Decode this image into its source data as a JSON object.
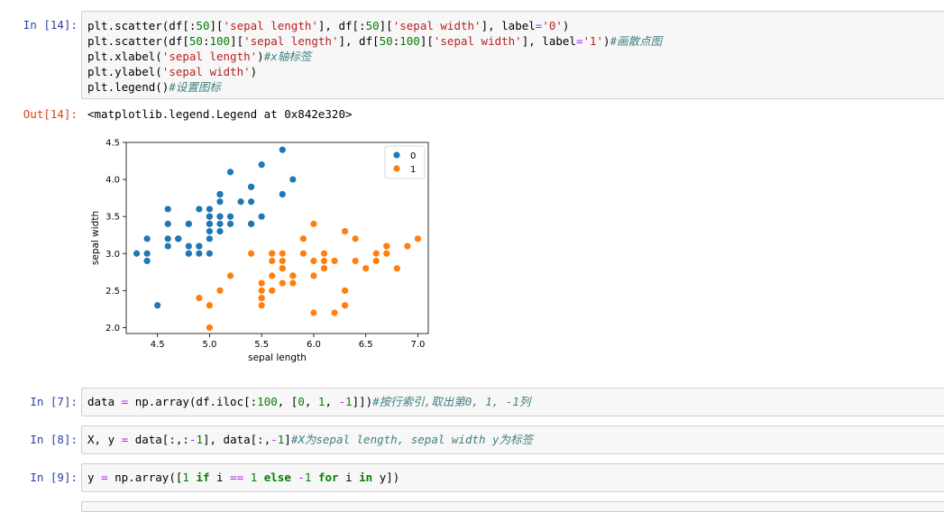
{
  "cells": {
    "c14": {
      "prompt": "In  [14]:",
      "out_prompt": "Out[14]:",
      "output": "<matplotlib.legend.Legend at 0x842e320>"
    },
    "c7": {
      "prompt": "In  [7]:"
    },
    "c8": {
      "prompt": "In  [8]:"
    },
    "c9": {
      "prompt": "In  [9]:"
    }
  },
  "code_tokens": {
    "c14_l1": [
      [
        "",
        "plt.scatter(df[:"
      ],
      [
        "num",
        "50"
      ],
      [
        "",
        "]["
      ],
      [
        "str",
        "'sepal length'"
      ],
      [
        "",
        "], df[:"
      ],
      [
        "num",
        "50"
      ],
      [
        "",
        "]["
      ],
      [
        "str",
        "'sepal width'"
      ],
      [
        "",
        "], label"
      ],
      [
        "op",
        "="
      ],
      [
        "str",
        "'0'"
      ],
      [
        "",
        ")"
      ]
    ],
    "c14_l2": [
      [
        "",
        "plt.scatter(df["
      ],
      [
        "num",
        "50"
      ],
      [
        "",
        ":"
      ],
      [
        "num",
        "100"
      ],
      [
        "",
        "]["
      ],
      [
        "str",
        "'sepal length'"
      ],
      [
        "",
        "], df["
      ],
      [
        "num",
        "50"
      ],
      [
        "",
        ":"
      ],
      [
        "num",
        "100"
      ],
      [
        "",
        "]["
      ],
      [
        "str",
        "'sepal width'"
      ],
      [
        "",
        "], label"
      ],
      [
        "op",
        "="
      ],
      [
        "str",
        "'1'"
      ],
      [
        "",
        ")"
      ],
      [
        "cmt",
        "#画散点图"
      ]
    ],
    "c14_l3": [
      [
        "",
        "plt.xlabel("
      ],
      [
        "str",
        "'sepal length'"
      ],
      [
        "",
        ")"
      ],
      [
        "cmt",
        "#x轴标签"
      ]
    ],
    "c14_l4": [
      [
        "",
        "plt.ylabel("
      ],
      [
        "str",
        "'sepal width'"
      ],
      [
        "",
        ")"
      ]
    ],
    "c14_l5": [
      [
        "",
        "plt.legend()"
      ],
      [
        "cmt",
        "#设置图标"
      ]
    ],
    "c7_l1": [
      [
        "",
        "data "
      ],
      [
        "op",
        "="
      ],
      [
        "",
        " np.array(df.iloc[:"
      ],
      [
        "num",
        "100"
      ],
      [
        "",
        ", ["
      ],
      [
        "num",
        "0"
      ],
      [
        "",
        ", "
      ],
      [
        "num",
        "1"
      ],
      [
        "",
        ", "
      ],
      [
        "op",
        "-"
      ],
      [
        "num",
        "1"
      ],
      [
        "",
        "]])"
      ],
      [
        "cmt",
        "#按行索引,取出第0, 1, -1列"
      ]
    ],
    "c8_l1": [
      [
        "",
        "X, y "
      ],
      [
        "op",
        "="
      ],
      [
        "",
        " data[:,:"
      ],
      [
        "op",
        "-"
      ],
      [
        "num",
        "1"
      ],
      [
        "",
        "], data[:,"
      ],
      [
        "op",
        "-"
      ],
      [
        "num",
        "1"
      ],
      [
        "",
        "]"
      ],
      [
        "cmt",
        "#X为sepal length, sepal width y为标签"
      ]
    ],
    "c9_l1": [
      [
        "",
        "y "
      ],
      [
        "op",
        "="
      ],
      [
        "",
        " np.array(["
      ],
      [
        "num",
        "1"
      ],
      [
        "",
        " "
      ],
      [
        "kw",
        "if"
      ],
      [
        "",
        " i "
      ],
      [
        "op",
        "=="
      ],
      [
        "",
        " "
      ],
      [
        "num",
        "1"
      ],
      [
        "",
        " "
      ],
      [
        "kw",
        "else"
      ],
      [
        "",
        " "
      ],
      [
        "op",
        "-"
      ],
      [
        "num",
        "1"
      ],
      [
        "",
        " "
      ],
      [
        "kw",
        "for"
      ],
      [
        "",
        " i "
      ],
      [
        "kw",
        "in"
      ],
      [
        "",
        " y])"
      ]
    ]
  },
  "colors": {
    "series0": "#1f77b4",
    "series1": "#ff7f0e",
    "prompt_in": "#303f9f",
    "prompt_out": "#d84315"
  },
  "chart_data": {
    "type": "scatter",
    "xlabel": "sepal length",
    "ylabel": "sepal width",
    "xlim": [
      4.2,
      7.1
    ],
    "ylim": [
      1.92,
      4.5
    ],
    "xticks": [
      "4.5",
      "5.0",
      "5.5",
      "6.0",
      "6.5",
      "7.0"
    ],
    "xtick_values": [
      4.5,
      5.0,
      5.5,
      6.0,
      6.5,
      7.0
    ],
    "yticks": [
      "2.0",
      "2.5",
      "3.0",
      "3.5",
      "4.0",
      "4.5"
    ],
    "ytick_values": [
      2.0,
      2.5,
      3.0,
      3.5,
      4.0,
      4.5
    ],
    "legend_position": "top-right",
    "grid": false,
    "series": [
      {
        "name": "0",
        "points": [
          [
            5.1,
            3.5
          ],
          [
            4.9,
            3.0
          ],
          [
            4.7,
            3.2
          ],
          [
            4.6,
            3.1
          ],
          [
            5.0,
            3.6
          ],
          [
            5.4,
            3.9
          ],
          [
            4.6,
            3.4
          ],
          [
            5.0,
            3.4
          ],
          [
            4.4,
            2.9
          ],
          [
            4.9,
            3.1
          ],
          [
            5.4,
            3.7
          ],
          [
            4.8,
            3.4
          ],
          [
            4.8,
            3.0
          ],
          [
            4.3,
            3.0
          ],
          [
            5.8,
            4.0
          ],
          [
            5.7,
            4.4
          ],
          [
            5.4,
            3.9
          ],
          [
            5.1,
            3.5
          ],
          [
            5.7,
            3.8
          ],
          [
            5.1,
            3.8
          ],
          [
            5.4,
            3.4
          ],
          [
            5.1,
            3.7
          ],
          [
            4.6,
            3.6
          ],
          [
            5.1,
            3.3
          ],
          [
            4.8,
            3.4
          ],
          [
            5.0,
            3.0
          ],
          [
            5.0,
            3.4
          ],
          [
            5.2,
            3.5
          ],
          [
            5.2,
            3.4
          ],
          [
            4.7,
            3.2
          ],
          [
            4.8,
            3.1
          ],
          [
            5.4,
            3.4
          ],
          [
            5.2,
            4.1
          ],
          [
            5.5,
            4.2
          ],
          [
            4.9,
            3.1
          ],
          [
            5.0,
            3.2
          ],
          [
            5.5,
            3.5
          ],
          [
            4.9,
            3.6
          ],
          [
            4.4,
            3.0
          ],
          [
            5.1,
            3.4
          ],
          [
            5.0,
            3.5
          ],
          [
            4.5,
            2.3
          ],
          [
            4.4,
            3.2
          ],
          [
            5.0,
            3.5
          ],
          [
            5.1,
            3.8
          ],
          [
            4.8,
            3.0
          ],
          [
            5.1,
            3.8
          ],
          [
            4.6,
            3.2
          ],
          [
            5.3,
            3.7
          ],
          [
            5.0,
            3.3
          ]
        ]
      },
      {
        "name": "1",
        "points": [
          [
            7.0,
            3.2
          ],
          [
            6.4,
            3.2
          ],
          [
            6.9,
            3.1
          ],
          [
            5.5,
            2.3
          ],
          [
            6.5,
            2.8
          ],
          [
            5.7,
            2.8
          ],
          [
            6.3,
            3.3
          ],
          [
            4.9,
            2.4
          ],
          [
            6.6,
            2.9
          ],
          [
            5.2,
            2.7
          ],
          [
            5.0,
            2.0
          ],
          [
            5.9,
            3.0
          ],
          [
            6.0,
            2.2
          ],
          [
            6.1,
            2.9
          ],
          [
            5.6,
            2.9
          ],
          [
            6.7,
            3.1
          ],
          [
            5.6,
            3.0
          ],
          [
            5.8,
            2.7
          ],
          [
            6.2,
            2.2
          ],
          [
            5.6,
            2.5
          ],
          [
            5.9,
            3.2
          ],
          [
            6.1,
            2.8
          ],
          [
            6.3,
            2.5
          ],
          [
            6.1,
            2.8
          ],
          [
            6.4,
            2.9
          ],
          [
            6.6,
            3.0
          ],
          [
            6.8,
            2.8
          ],
          [
            6.7,
            3.0
          ],
          [
            6.0,
            2.9
          ],
          [
            5.7,
            2.6
          ],
          [
            5.5,
            2.4
          ],
          [
            5.5,
            2.4
          ],
          [
            5.8,
            2.7
          ],
          [
            6.0,
            2.7
          ],
          [
            5.4,
            3.0
          ],
          [
            6.0,
            3.4
          ],
          [
            6.7,
            3.1
          ],
          [
            6.3,
            2.3
          ],
          [
            5.6,
            3.0
          ],
          [
            5.5,
            2.5
          ],
          [
            5.5,
            2.6
          ],
          [
            6.1,
            3.0
          ],
          [
            5.8,
            2.6
          ],
          [
            5.0,
            2.3
          ],
          [
            5.6,
            2.7
          ],
          [
            5.7,
            3.0
          ],
          [
            5.7,
            2.9
          ],
          [
            6.2,
            2.9
          ],
          [
            5.1,
            2.5
          ],
          [
            5.7,
            2.8
          ]
        ]
      }
    ]
  }
}
